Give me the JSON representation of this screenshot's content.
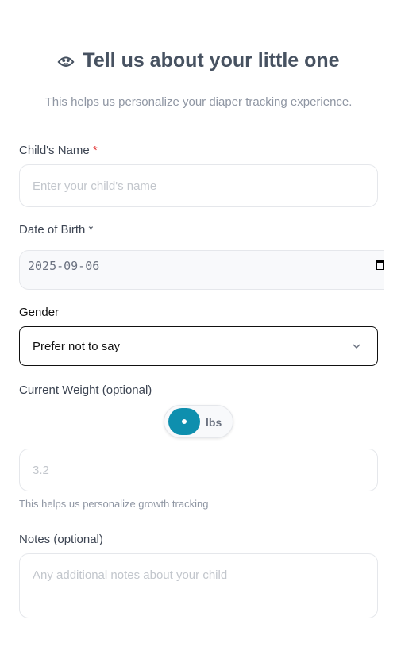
{
  "header": {
    "title": "Tell us about your little one",
    "subtitle": "This helps us personalize your diaper tracking experience.",
    "icon": "baby-face-icon"
  },
  "fields": {
    "name": {
      "label": "Child's Name",
      "required_mark": "*",
      "placeholder": "Enter your child's name"
    },
    "dob": {
      "label": "Date of Birth *",
      "value": "2025-09-06"
    },
    "gender": {
      "label": "Gender",
      "value": "Prefer not to say"
    },
    "weight": {
      "label": "Current Weight (optional)",
      "unit": "lbs",
      "placeholder": "3.2",
      "hint": "This helps us personalize growth tracking"
    },
    "notes": {
      "label": "Notes (optional)",
      "placeholder": "Any additional notes about your child"
    }
  },
  "colors": {
    "accent": "#0e8fae"
  }
}
